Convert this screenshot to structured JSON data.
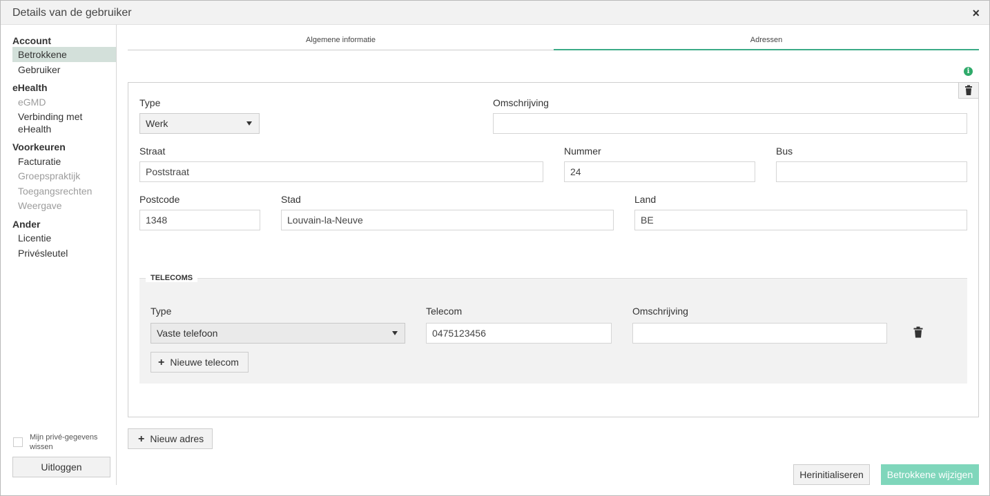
{
  "dialog": {
    "title": "Details van de gebruiker",
    "close_symbol": "×"
  },
  "sidebar": {
    "sections": [
      {
        "title": "Account",
        "items": [
          {
            "label": "Betrokkene",
            "state": "active"
          },
          {
            "label": "Gebruiker",
            "state": "normal"
          }
        ]
      },
      {
        "title": "eHealth",
        "items": [
          {
            "label": "eGMD",
            "state": "disabled"
          },
          {
            "label": "Verbinding met eHealth",
            "state": "normal"
          }
        ]
      },
      {
        "title": "Voorkeuren",
        "items": [
          {
            "label": "Facturatie",
            "state": "normal"
          },
          {
            "label": "Groepspraktijk",
            "state": "disabled"
          },
          {
            "label": "Toegangsrechten",
            "state": "disabled"
          },
          {
            "label": "Weergave",
            "state": "disabled"
          }
        ]
      },
      {
        "title": "Ander",
        "items": [
          {
            "label": "Licentie",
            "state": "normal"
          },
          {
            "label": "Privésleutel",
            "state": "normal"
          }
        ]
      }
    ],
    "privacy_label": "Mijn privé-gegevens wissen",
    "logout_label": "Uitloggen"
  },
  "tabs": [
    {
      "label": "Algemene informatie",
      "active": false
    },
    {
      "label": "Adressen",
      "active": true
    }
  ],
  "address": {
    "type_label": "Type",
    "type_value": "Werk",
    "omschrijving_label": "Omschrijving",
    "omschrijving_value": "",
    "straat_label": "Straat",
    "straat_value": "Poststraat",
    "nummer_label": "Nummer",
    "nummer_value": "24",
    "bus_label": "Bus",
    "bus_value": "",
    "postcode_label": "Postcode",
    "postcode_value": "1348",
    "stad_label": "Stad",
    "stad_value": "Louvain-la-Neuve",
    "land_label": "Land",
    "land_value": "BE"
  },
  "telecoms": {
    "legend": "TELECOMS",
    "type_label": "Type",
    "type_value": "Vaste telefoon",
    "telecom_label": "Telecom",
    "telecom_value": "0475123456",
    "omschrijving_label": "Omschrijving",
    "omschrijving_value": "",
    "new_label": "Nieuwe telecom"
  },
  "actions": {
    "new_address_label": "Nieuw adres",
    "reset_label": "Herinitialiseren",
    "save_label": "Betrokkene wijzigen"
  },
  "colors": {
    "accent": "#3aaa86",
    "active_nav_bg": "#d3e0da",
    "primary_btn": "#7fd6bb",
    "info": "#2faa6a"
  },
  "icons": {
    "info": "info-icon",
    "trash": "trash-icon",
    "close": "close-icon",
    "plus": "plus-icon",
    "caret": "chevron-down-icon"
  }
}
